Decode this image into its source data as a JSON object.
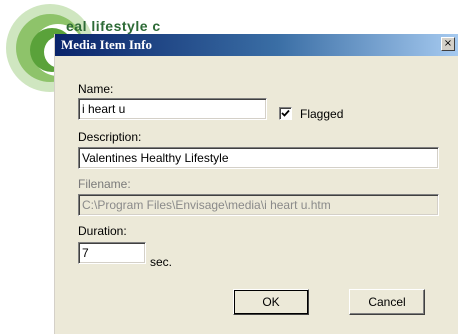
{
  "background": {
    "partial_text": "eal lifestyle c"
  },
  "dialog": {
    "title": "Media Item Info",
    "close_label": "×",
    "name_label": "Name:",
    "name_value": "i heart u",
    "flagged_label": "Flagged",
    "flagged_checked": true,
    "description_label": "Description:",
    "description_value": "Valentines Healthy Lifestyle",
    "filename_label": "Filename:",
    "filename_value": "C:\\Program Files\\Envisage\\media\\i heart u.htm",
    "duration_label": "Duration:",
    "duration_value": "7",
    "duration_unit": "sec.",
    "ok_label": "OK",
    "cancel_label": "Cancel"
  },
  "colors": {
    "titlebar_start": "#0a246a",
    "titlebar_end": "#a6caf0",
    "dialog_bg": "#ece9d8",
    "logo_green": "#6fae4e"
  },
  "icons": {
    "logo": "green-swirl-logo",
    "close": "close-icon",
    "check": "checkmark-icon"
  }
}
